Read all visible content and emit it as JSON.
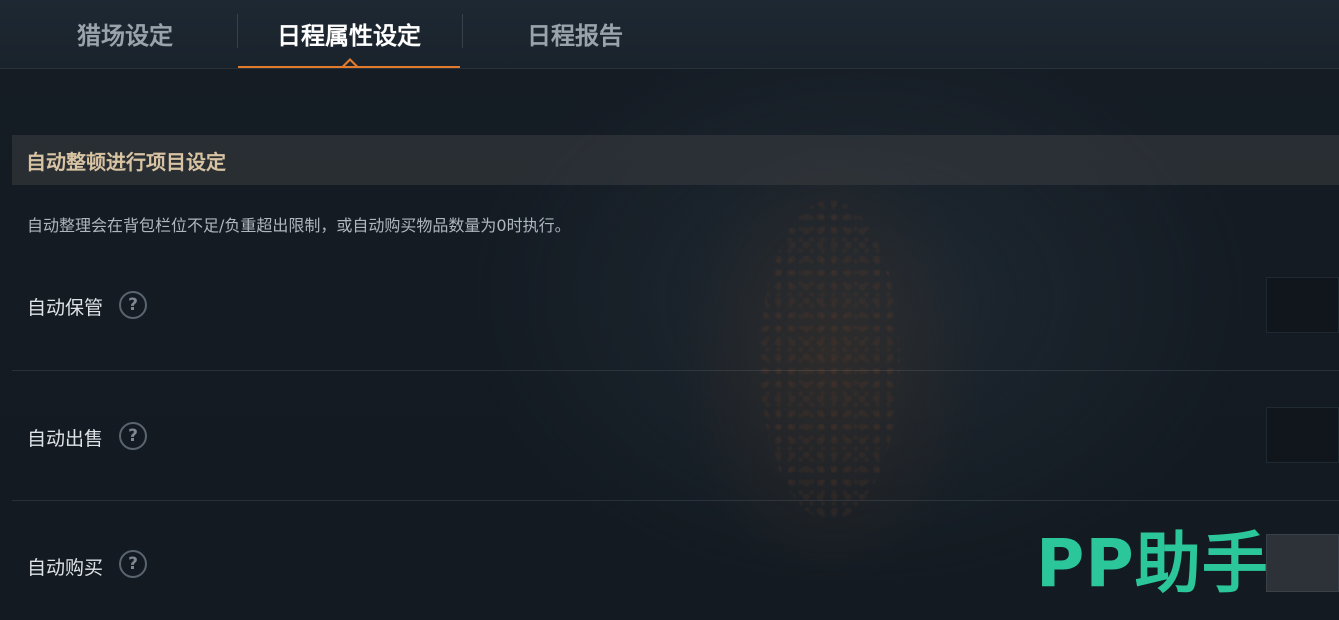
{
  "tabs": [
    {
      "label": "猎场设定",
      "active": false
    },
    {
      "label": "日程属性设定",
      "active": true
    },
    {
      "label": "日程报告",
      "active": false
    }
  ],
  "section": {
    "title": "自动整顿进行项目设定",
    "description": "自动整理会在背包栏位不足/负重超出限制，或自动购买物品数量为0时执行。"
  },
  "settings": [
    {
      "label": "自动保管",
      "help": "?"
    },
    {
      "label": "自动出售",
      "help": "?"
    },
    {
      "label": "自动购买",
      "help": "?"
    }
  ],
  "watermark": {
    "text": "PP助手"
  },
  "colors": {
    "accent": "#e07a2c",
    "section_title": "#d8c3a2",
    "watermark": "#2bc79b"
  }
}
